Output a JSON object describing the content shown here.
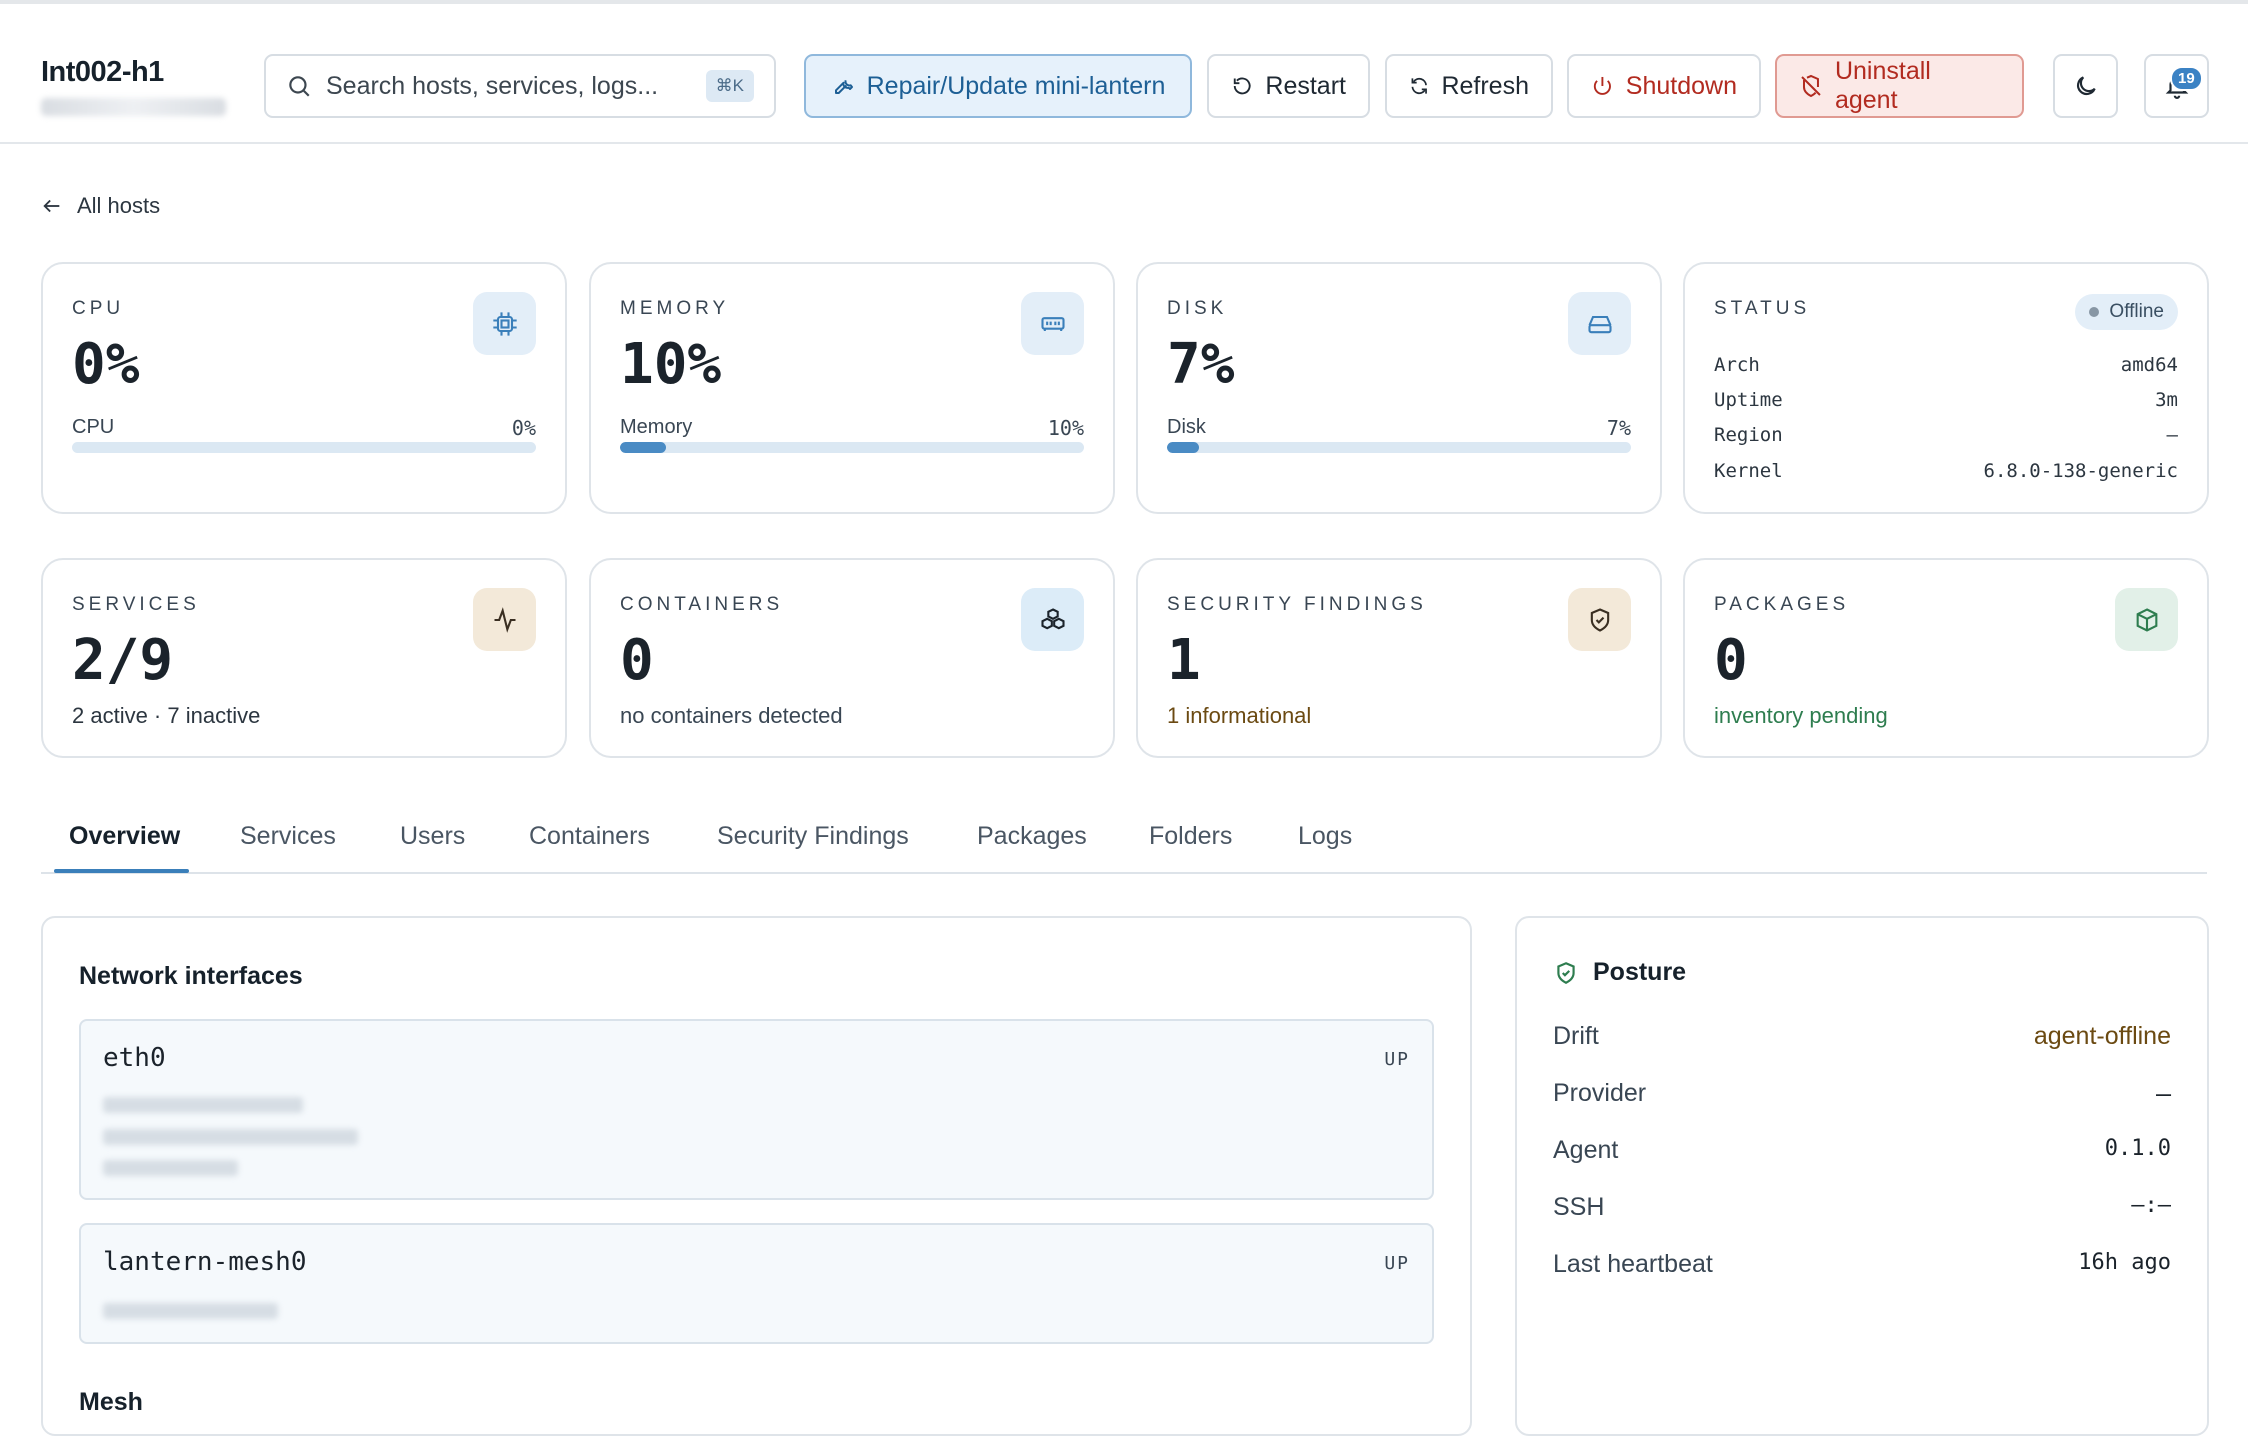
{
  "header": {
    "host_name": "Int002-h1",
    "search_placeholder": "Search hosts, services, logs...",
    "search_shortcut": "⌘K",
    "repair_label": "Repair/Update mini-lantern",
    "restart_label": "Restart",
    "refresh_label": "Refresh",
    "shutdown_label": "Shutdown",
    "uninstall_label": "Uninstall agent",
    "notification_count": "19"
  },
  "nav": {
    "back_label": "All hosts"
  },
  "metrics": {
    "cpu": {
      "label": "CPU",
      "value": "0%",
      "bar_label": "CPU",
      "bar_value": "0%",
      "fraction": 0.0
    },
    "memory": {
      "label": "MEMORY",
      "value": "10%",
      "bar_label": "Memory",
      "bar_value": "10%",
      "fraction": 0.1
    },
    "disk": {
      "label": "DISK",
      "value": "7%",
      "bar_label": "Disk",
      "bar_value": "7%",
      "fraction": 0.07
    },
    "status": {
      "label": "STATUS",
      "badge": "Offline",
      "rows": [
        {
          "key": "Arch",
          "value": "amd64"
        },
        {
          "key": "Uptime",
          "value": "3m"
        },
        {
          "key": "Region",
          "value": "—"
        },
        {
          "key": "Kernel",
          "value": "6.8.0-138-generic"
        }
      ]
    }
  },
  "summary": {
    "services": {
      "label": "SERVICES",
      "value": "2/9",
      "sub": "2 active · 7 inactive"
    },
    "containers": {
      "label": "CONTAINERS",
      "value": "0",
      "sub": "no containers detected"
    },
    "security": {
      "label": "SECURITY FINDINGS",
      "value": "1",
      "sub": "1 informational"
    },
    "packages": {
      "label": "PACKAGES",
      "value": "0",
      "sub": "inventory pending"
    }
  },
  "tabs": [
    "Overview",
    "Services",
    "Users",
    "Containers",
    "Security Findings",
    "Packages",
    "Folders",
    "Logs"
  ],
  "network": {
    "title": "Network interfaces",
    "interfaces": [
      {
        "name": "eth0",
        "state": "UP"
      },
      {
        "name": "lantern-mesh0",
        "state": "UP"
      }
    ],
    "next_section": "Mesh"
  },
  "posture": {
    "title": "Posture",
    "rows": [
      {
        "key": "Drift",
        "value": "agent-offline"
      },
      {
        "key": "Provider",
        "value": "—"
      },
      {
        "key": "Agent",
        "value": "0.1.0"
      },
      {
        "key": "SSH",
        "value": "—:—"
      },
      {
        "key": "Last heartbeat",
        "value": "16h ago"
      }
    ]
  },
  "colors": {
    "accent": "#3a7fba",
    "danger": "#b22b20",
    "success": "#2e7d4f",
    "warning_text": "#6b4a12"
  }
}
